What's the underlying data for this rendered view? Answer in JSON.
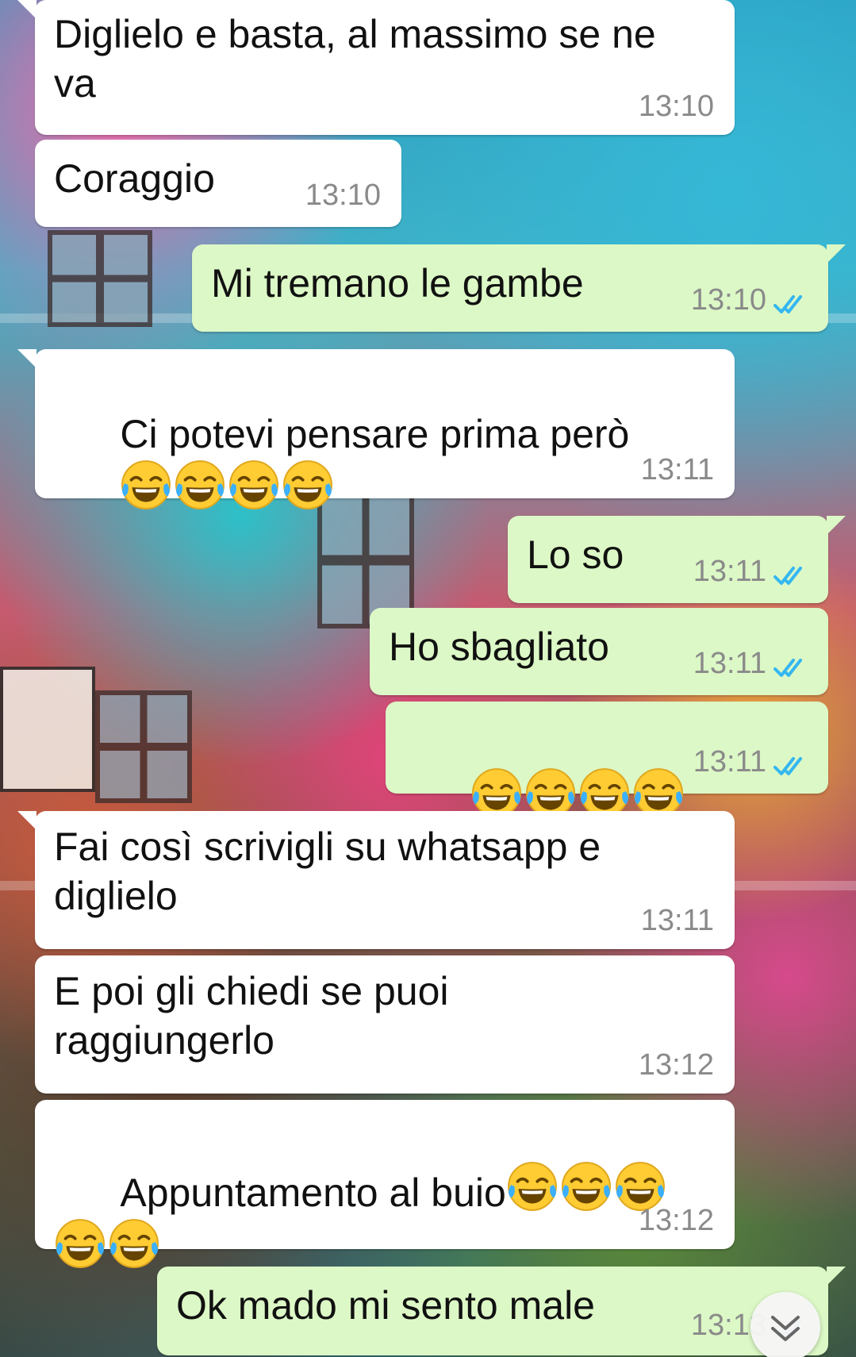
{
  "chat": {
    "messages": [
      {
        "dir": "in",
        "text": "Diglielo e basta, al massimo se ne\nva",
        "time": "13:10",
        "emoji_count": 0
      },
      {
        "dir": "in",
        "text": "Coraggio",
        "time": "13:10",
        "emoji_count": 0
      },
      {
        "dir": "out",
        "text": "Mi tremano le gambe",
        "time": "13:10",
        "status": "read",
        "emoji_count": 0
      },
      {
        "dir": "in",
        "text": "Ci potevi pensare prima però",
        "time": "13:11",
        "emoji": "tears-of-joy",
        "emoji_count": 4
      },
      {
        "dir": "out",
        "text": "Lo so",
        "time": "13:11",
        "status": "read",
        "emoji_count": 0
      },
      {
        "dir": "out",
        "text": "Ho sbagliato",
        "time": "13:11",
        "status": "read",
        "emoji_count": 0
      },
      {
        "dir": "out",
        "text": "",
        "time": "13:11",
        "status": "read",
        "emoji": "tears-of-joy",
        "emoji_count": 4
      },
      {
        "dir": "in",
        "text": "Fai così scrivigli su whatsapp e\ndiglielo",
        "time": "13:11",
        "emoji_count": 0
      },
      {
        "dir": "in",
        "text": "E poi gli chiedi se puoi\nraggiungerlo",
        "time": "13:12",
        "emoji_count": 0
      },
      {
        "dir": "in",
        "text": "Appuntamento al buio",
        "time": "13:12",
        "emoji": "tears-of-joy",
        "emoji_count": 5
      },
      {
        "dir": "out",
        "text": "Ok mado mi sento male",
        "time": "13:13",
        "status": "read",
        "emoji_count": 0
      }
    ]
  },
  "icons": {
    "read_ticks": "double-check-icon",
    "emoji": "tears-of-joy-emoji",
    "scroll_down": "chevron-double-down-icon"
  },
  "colors": {
    "incoming_bubble": "#ffffff",
    "outgoing_bubble": "#dcf8c6",
    "read_tick": "#34b7f1",
    "timestamp": "#8a8a8a"
  }
}
